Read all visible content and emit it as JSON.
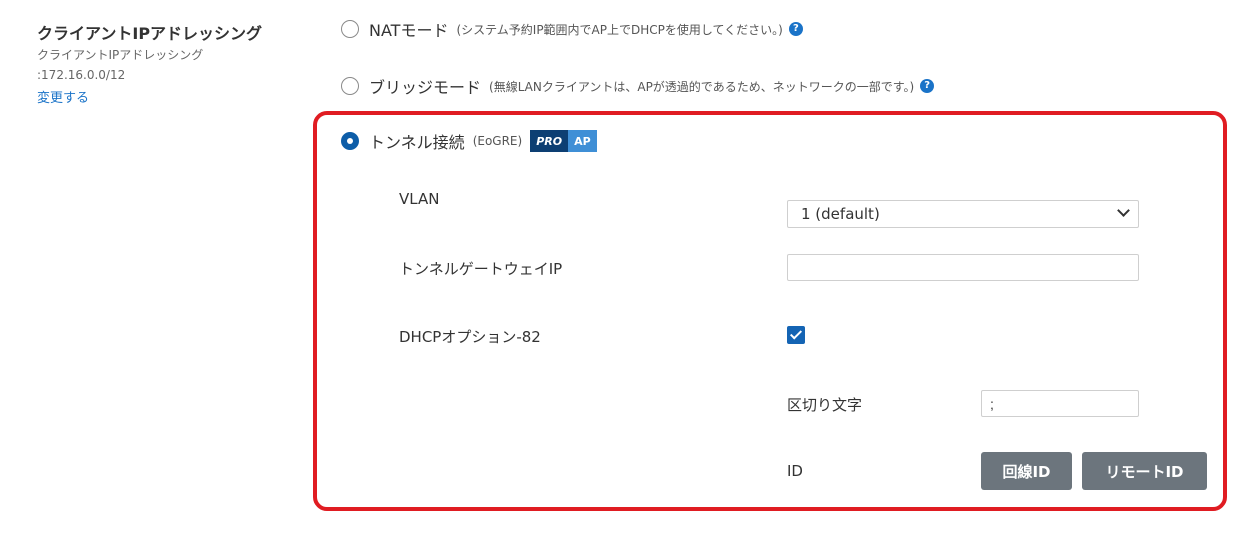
{
  "client_ip": {
    "title": "クライアントIPアドレッシング",
    "description_line1": "クライアントIPアドレッシング",
    "description_line2": ":172.16.0.0/12",
    "change_link": "変更する"
  },
  "modes": [
    {
      "label": "NATモード",
      "note": "(システム予約IP範囲内でAP上でDHCPを使用してください。)",
      "selected": false,
      "help_icon": "question-circle-icon",
      "help_glyph": "?"
    },
    {
      "label": "ブリッジモード",
      "note": "(無線LANクライアントは、APが透過的であるため、ネットワークの一部です。)",
      "selected": false,
      "help_icon": "question-circle-icon",
      "help_glyph": "?"
    },
    {
      "label": "トンネル接続",
      "note": "(EoGRE)",
      "selected": true,
      "badge": {
        "pro": "PRO",
        "ap": "AP"
      }
    }
  ],
  "tunnel": {
    "vlan": {
      "label": "VLAN",
      "selected_value": "1 (default)"
    },
    "gateway_ip": {
      "label": "トンネルゲートウェイIP",
      "value": ""
    },
    "dhcp_option82": {
      "label": "DHCPオプション-82",
      "checked": true,
      "delimiter": {
        "label": "区切り文字",
        "value": ";"
      },
      "id": {
        "label": "ID",
        "circuit_id_button": "回線ID",
        "remote_id_button": "リモートID"
      }
    }
  },
  "colors": {
    "highlight_border": "#e01c22",
    "accent": "#0d5da8",
    "link": "#1a73c8",
    "button": "#6c757d"
  }
}
